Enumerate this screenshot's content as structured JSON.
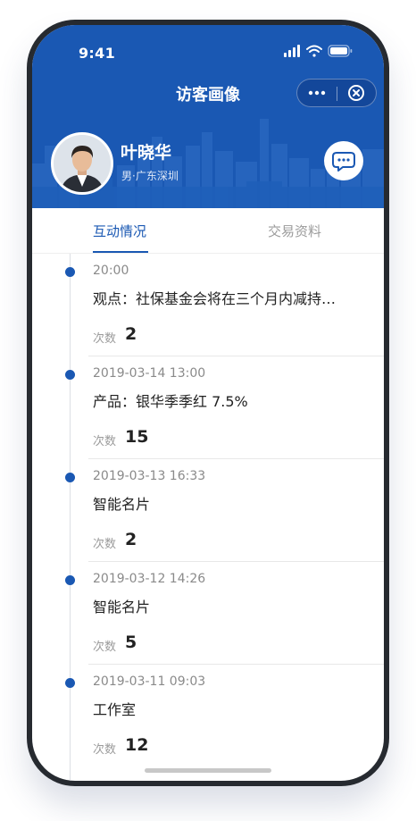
{
  "status": {
    "time": "9:41"
  },
  "nav": {
    "title": "访客画像"
  },
  "profile": {
    "name": "叶晓华",
    "meta": "男·广东深圳"
  },
  "tabs": [
    {
      "label": "互动情况",
      "active": true
    },
    {
      "label": "交易资料",
      "active": false
    }
  ],
  "timeline": {
    "count_label": "次数",
    "entries": [
      {
        "time": "20:00",
        "content": "观点：社保基金会将在三个月内减持…",
        "count": "2"
      },
      {
        "time": "2019-03-14 13:00",
        "content": "产品：银华季季红 7.5%",
        "count": "15"
      },
      {
        "time": "2019-03-13 16:33",
        "content": "智能名片",
        "count": "2"
      },
      {
        "time": "2019-03-12 14:26",
        "content": "智能名片",
        "count": "5"
      },
      {
        "time": "2019-03-11 09:03",
        "content": "工作室",
        "count": "12"
      }
    ]
  },
  "icons": {
    "status": [
      "signal-icon",
      "wifi-icon",
      "battery-icon"
    ],
    "capsule": [
      "more-icon",
      "close-circle-icon"
    ],
    "chat": "chat-bubble-icon"
  },
  "colors": {
    "primary": "#1a58b3",
    "text": "#222222",
    "muted": "#9b9b9b"
  }
}
